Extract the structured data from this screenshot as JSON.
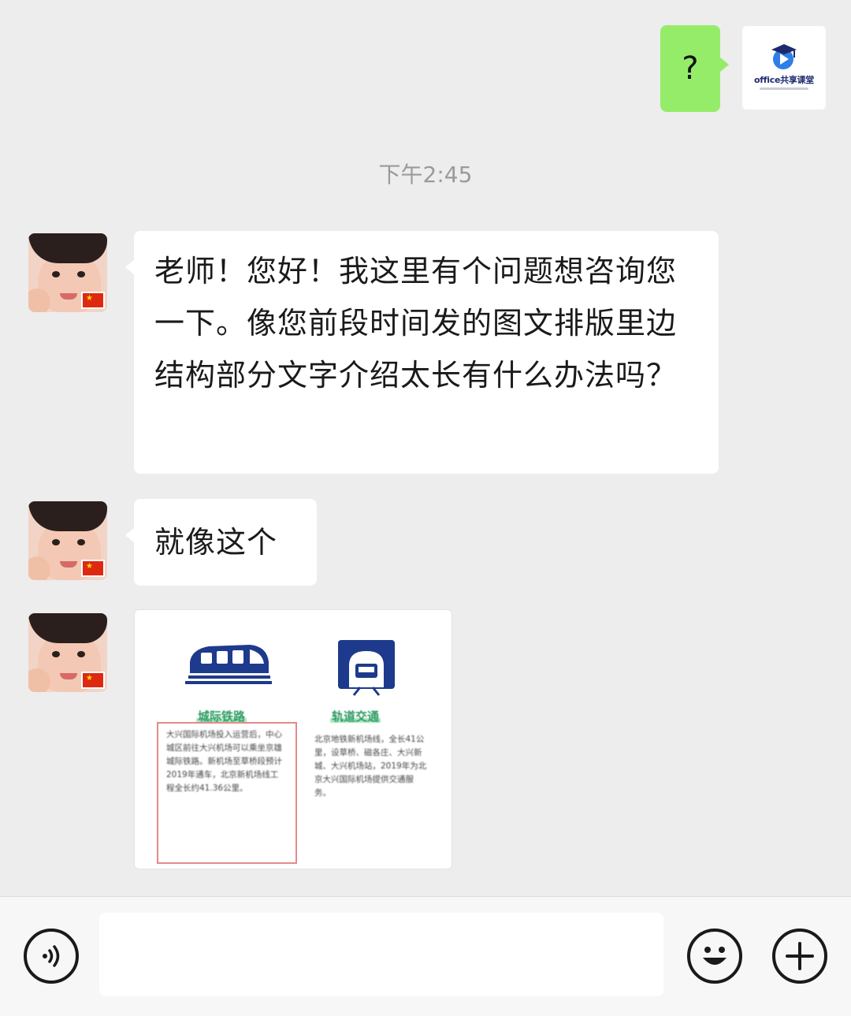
{
  "conversation": {
    "outgoing": [
      {
        "text": "?"
      }
    ],
    "self_avatar": {
      "icon": "office-course-logo-icon",
      "label": "office共享课堂"
    },
    "timestamp": "下午2:45",
    "incoming": [
      {
        "text": "老师！您好！我这里有个问题想咨询您一下。像您前段时间发的图文排版里边结构部分文字介绍太长有什么办法吗？"
      },
      {
        "text": "就像这个"
      }
    ],
    "image_message": {
      "columns": [
        {
          "icon": "train-icon",
          "title": "城际铁路",
          "body": "大兴国际机场投入运营后，中心城区前往大兴机场可以乘坐京雄城际铁路。新机场至草桥段预计2019年通车，北京新机场线工程全长约41.36公里。"
        },
        {
          "icon": "subway-tunnel-icon",
          "title": "轨道交通",
          "body": "北京地铁新机场线，全长41公里，设草桥、磁各庄、大兴新城、大兴机场站，2019年为北京大兴国际机场提供交通服务。"
        }
      ]
    }
  },
  "input_bar": {
    "voice_icon": "voice-icon",
    "placeholder": "",
    "emoji_icon": "emoji-icon",
    "add_icon": "plus-icon"
  },
  "colors": {
    "chat_background": "#ededed",
    "outgoing_bubble": "#95ec69",
    "incoming_bubble": "#ffffff",
    "timestamp": "#9a9a9a"
  }
}
